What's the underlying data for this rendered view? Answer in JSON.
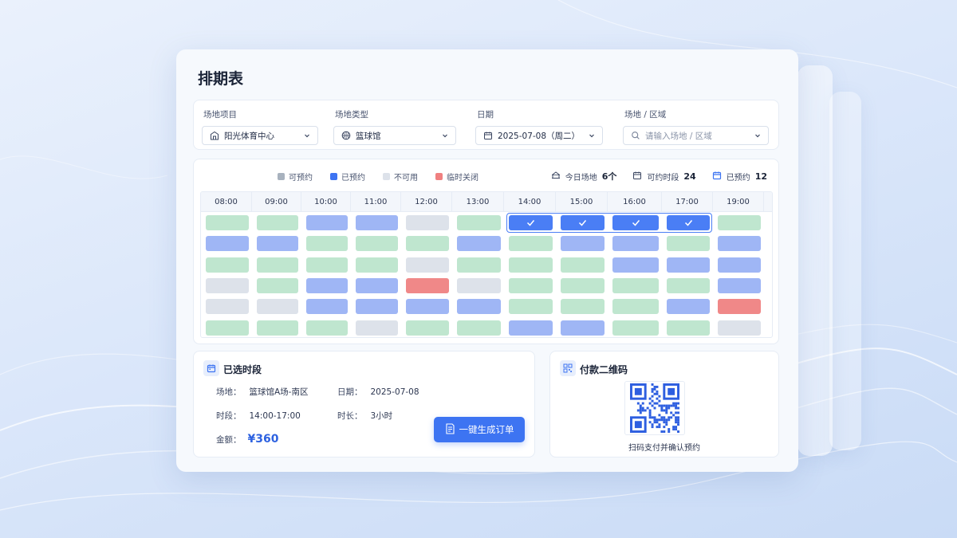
{
  "page": {
    "title": "排期表"
  },
  "filters": [
    {
      "label": "场地项目",
      "value": "阳光体育中心",
      "icon": "building-icon",
      "placeholder": false
    },
    {
      "label": "场地类型",
      "value": "篮球馆",
      "icon": "basketball-icon",
      "placeholder": false
    },
    {
      "label": "日期",
      "value": "2025-07-08（周二）",
      "icon": "calendar-icon",
      "placeholder": false
    },
    {
      "label": "场地 / 区域",
      "value": "请输入场地 / 区域",
      "icon": "search-icon",
      "placeholder": true
    }
  ],
  "legend": [
    {
      "label": "可预约",
      "color": "#a8b2be"
    },
    {
      "label": "已预约",
      "color": "#3d74f2"
    },
    {
      "label": "不可用",
      "color": "#dde2ea"
    },
    {
      "label": "临时关闭",
      "color": "#f08080"
    }
  ],
  "stats": [
    {
      "label": "今日场地",
      "value": "6个",
      "icon": "venue-icon"
    },
    {
      "label": "可约时段",
      "value": "24",
      "icon": "calendar-outline-icon"
    },
    {
      "label": "已预约",
      "value": "12",
      "icon": "calendar-blue-icon"
    }
  ],
  "schedule": {
    "times": [
      "08:00",
      "09:00",
      "10:00",
      "11:00",
      "12:00",
      "13:00",
      "14:00",
      "15:00",
      "16:00",
      "17:00",
      "19:00"
    ],
    "rows": [
      [
        "free",
        "free",
        "booked",
        "booked",
        "na",
        "free",
        "selected",
        "selected",
        "selected",
        "selected",
        "free"
      ],
      [
        "booked",
        "booked",
        "free",
        "free",
        "free",
        "booked",
        "free",
        "booked",
        "booked",
        "free",
        "booked"
      ],
      [
        "free",
        "free",
        "free",
        "free",
        "na",
        "free",
        "free",
        "free",
        "booked",
        "booked",
        "booked"
      ],
      [
        "na",
        "free",
        "booked",
        "booked",
        "closed",
        "na",
        "free",
        "free",
        "free",
        "free",
        "booked"
      ],
      [
        "na",
        "na",
        "booked",
        "booked",
        "booked",
        "booked",
        "free",
        "free",
        "free",
        "booked",
        "closed"
      ],
      [
        "free",
        "free",
        "free",
        "na",
        "free",
        "free",
        "booked",
        "booked",
        "free",
        "free",
        "na"
      ]
    ]
  },
  "selection": {
    "title": "已选时段",
    "venue_label": "场地：",
    "venue": "篮球馆A场-南区",
    "date_label": "日期：",
    "date": "2025-07-08",
    "time_label": "时段：",
    "time": "14:00-17:00",
    "duration_label": "时长：",
    "duration": "3小时",
    "amount_label": "金额：",
    "amount": "¥360",
    "order_button": "一键生成订单"
  },
  "payment": {
    "title": "付款二维码",
    "caption": "扫码支付并确认预约"
  }
}
